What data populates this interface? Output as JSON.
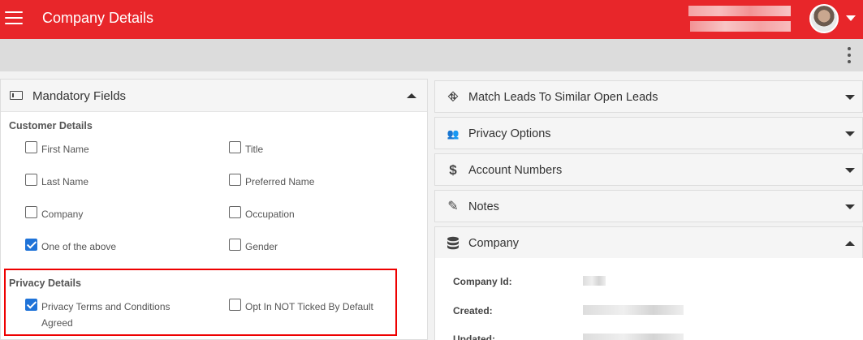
{
  "header": {
    "app_title": "Company Details",
    "menu_icon": "hamburger-icon",
    "colors": {
      "brand": "#e8262a",
      "checkbox_checked": "#1f73d8",
      "highlight": "#e00000"
    }
  },
  "mandatory_fields": {
    "title": "Mandatory Fields",
    "customer_details": {
      "label": "Customer Details",
      "fields": [
        {
          "label": "First Name",
          "checked": false
        },
        {
          "label": "Title",
          "checked": false
        },
        {
          "label": "Last Name",
          "checked": false
        },
        {
          "label": "Preferred Name",
          "checked": false
        },
        {
          "label": "Company",
          "checked": false
        },
        {
          "label": "Occupation",
          "checked": false
        },
        {
          "label": "One of the above",
          "checked": true
        },
        {
          "label": "Gender",
          "checked": false
        }
      ]
    },
    "privacy_details": {
      "label": "Privacy Details",
      "fields": [
        {
          "label_line1": "Privacy Terms and Conditions",
          "label_line2": "Agreed",
          "checked": true
        },
        {
          "label": "Opt In NOT Ticked By Default",
          "checked": false
        }
      ]
    }
  },
  "accordions": [
    {
      "title": "Match Leads To Similar Open Leads",
      "icon": "sitemap-icon",
      "expanded": false
    },
    {
      "title": "Privacy Options",
      "icon": "users-icon",
      "expanded": false
    },
    {
      "title": "Account Numbers",
      "icon": "dollar-icon",
      "expanded": false
    },
    {
      "title": "Notes",
      "icon": "edit-note-icon",
      "expanded": false
    },
    {
      "title": "Company",
      "icon": "database-icon",
      "expanded": true
    }
  ],
  "company": {
    "id_label": "Company Id:",
    "created_label": "Created:",
    "updated_label": "Updated:"
  }
}
